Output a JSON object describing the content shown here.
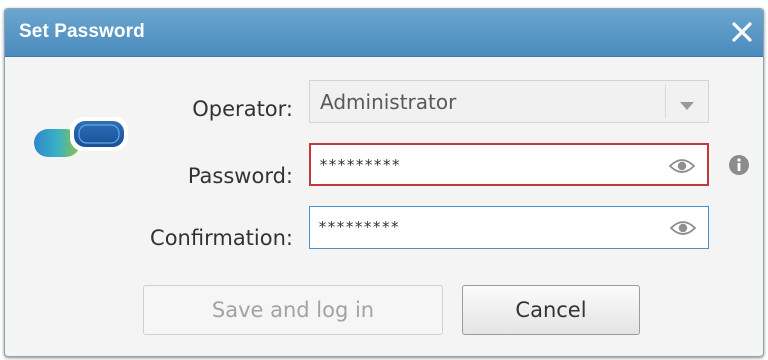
{
  "dialog": {
    "title": "Set Password",
    "close_icon": "close-icon",
    "logo_icon": "app-logo-icon"
  },
  "form": {
    "operator": {
      "label": "Operator:",
      "value": "Administrator",
      "dropdown_icon": "chevron-down-icon"
    },
    "password": {
      "label": "Password:",
      "value": "*********",
      "show_icon": "eye-icon",
      "info_icon": "info-icon"
    },
    "confirmation": {
      "label": "Confirmation:",
      "value": "*********",
      "show_icon": "eye-icon"
    }
  },
  "buttons": {
    "save_label": "Save and log in",
    "cancel_label": "Cancel"
  },
  "colors": {
    "titlebar": "#5a98c7",
    "error_border": "#c0393b",
    "focus_border": "#4a90c9"
  }
}
